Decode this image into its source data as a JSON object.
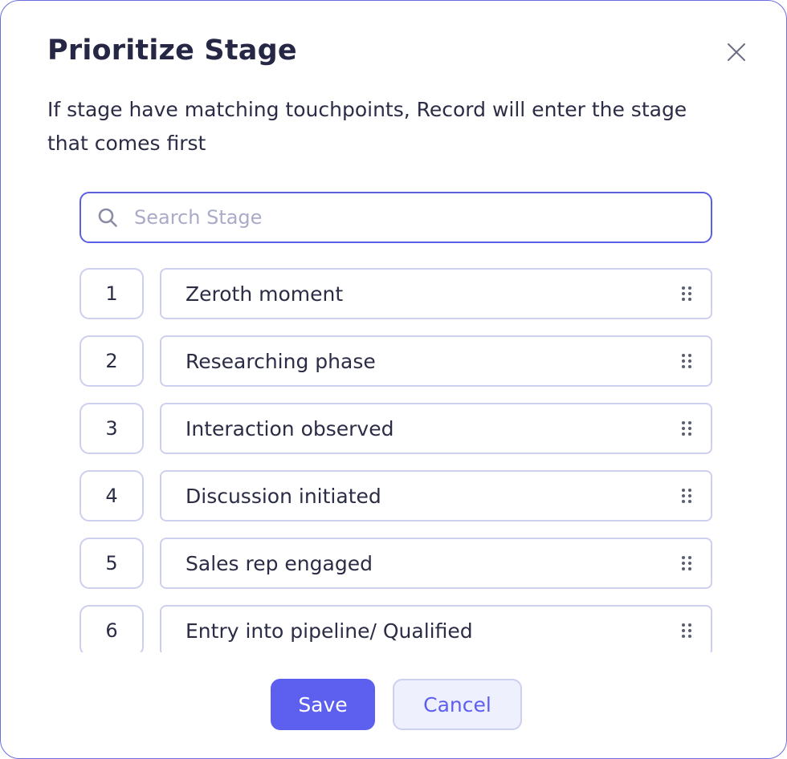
{
  "dialog": {
    "title": "Prioritize Stage",
    "description": "If stage have matching touchpoints, Record will enter the stage that comes first",
    "close_icon": "close-icon"
  },
  "search": {
    "placeholder": "Search Stage",
    "value": "",
    "icon": "search-icon"
  },
  "stages": [
    {
      "rank": "1",
      "label": "Zeroth moment"
    },
    {
      "rank": "2",
      "label": "Researching phase"
    },
    {
      "rank": "3",
      "label": "Interaction observed"
    },
    {
      "rank": "4",
      "label": "Discussion initiated"
    },
    {
      "rank": "5",
      "label": "Sales rep engaged"
    },
    {
      "rank": "6",
      "label": "Entry into pipeline/ Qualified"
    }
  ],
  "buttons": {
    "save_label": "Save",
    "cancel_label": "Cancel"
  },
  "colors": {
    "accent": "#5d5fef",
    "border": "#cdcfee",
    "text": "#2b2c45",
    "placeholder": "#a9abc8"
  }
}
